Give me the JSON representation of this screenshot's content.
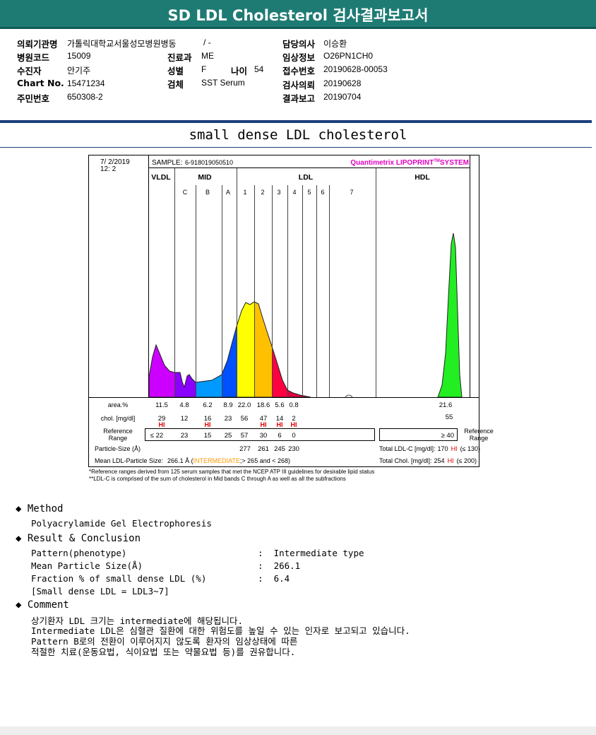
{
  "header": {
    "title": "SD LDL Cholesterol 검사결과보고서"
  },
  "info": {
    "institution": {
      "label": "의뢰기관명",
      "value": "가톨릭대학교서울성모병원병동",
      "ward": "/ -"
    },
    "doctor": {
      "label": "담당의사",
      "value": "이승환"
    },
    "hospital_code": {
      "label": "병원코드",
      "value": "15009"
    },
    "department": {
      "label": "진료과",
      "value": "ME"
    },
    "clinical_info": {
      "label": "임상정보",
      "value": "O26PN1CH0"
    },
    "patient": {
      "label": "수진자",
      "value": "안기주"
    },
    "sex": {
      "label": "성별",
      "value": "F"
    },
    "age": {
      "label": "나이",
      "value": "54"
    },
    "receipt_no": {
      "label": "접수번호",
      "value": "20190628-00053"
    },
    "chart_no": {
      "label": "Chart No.",
      "value": "15471234"
    },
    "specimen": {
      "label": "검체",
      "value": "SST Serum"
    },
    "request_date": {
      "label": "검사의뢰",
      "value": "20190628"
    },
    "resident_no": {
      "label": "주민번호",
      "value": "650308-2"
    },
    "report_date": {
      "label": "결과보고",
      "value": "20190704"
    }
  },
  "section_title": "small dense LDL cholesterol",
  "lipoprint": {
    "date": "7/ 2/2019",
    "time": "12: 2",
    "sample_label": "SAMPLE:",
    "sample": "6-918019050510",
    "brand": "Quantimetrix LIPOPRINT",
    "brand_tm": "TM",
    "brand_suffix": "SYSTEM",
    "groups": [
      "VLDL",
      "MID",
      "LDL",
      "HDL"
    ],
    "bands": [
      "C",
      "B",
      "A",
      "1",
      "2",
      "3",
      "4",
      "5",
      "6",
      "7"
    ],
    "area_label": "area.%",
    "area": [
      "11.5",
      "4.8",
      "6.2",
      "8.9",
      "22.0",
      "18.6",
      "5.6",
      "0.8"
    ],
    "hdl_area": "21.6",
    "chol_label": "chol. [mg/dl]",
    "chol": [
      "29",
      "12",
      "16",
      "23",
      "56",
      "47",
      "14",
      "2"
    ],
    "hdl_chol": "55",
    "hi_flags": [
      true,
      false,
      true,
      false,
      false,
      true,
      true,
      true
    ],
    "hi_text": "HI",
    "ref_label": "Reference Range",
    "ref": [
      "≤ 22",
      "23",
      "15",
      "25",
      "57",
      "30",
      "6",
      "0"
    ],
    "hdl_ref": "≥ 40",
    "particle_label": "Particle-Size (Å)",
    "particle": [
      "277",
      "261",
      "245",
      "230"
    ],
    "mean_label": "Mean LDL-Particle Size:",
    "mean_value": "266.1 Å",
    "mean_class": "INTERMEDIATE",
    "mean_range": ";> 265 and < 268)",
    "total_ldl_label": "Total LDL-C [mg/dl]:",
    "total_ldl": "170",
    "total_ldl_ref": "(≤ 130)",
    "total_chol_label": "Total Chol. [mg/dl]:",
    "total_chol": "254",
    "total_chol_ref": "(≤ 200)",
    "footnote1": "*Reference ranges derived from 125 serum samples that met the NCEP ATP III guidelines for desirable lipid status",
    "footnote2": "**LDL-C is comprised of the sum of cholesterol in Mid bands C through A as well as all the subfractions",
    "colors": {
      "VLDL": "#cc00ff",
      "C": "#8a00ff",
      "B": "#0099ff",
      "A": "#0050ff",
      "1": "#ffff00",
      "2": "#ffc000",
      "3": "#ff0040",
      "4": "#e00040",
      "HDL": "#22ee22",
      "hi": "#e00000",
      "intermediate": "#ff9900",
      "brand": "#e000c0"
    }
  },
  "method": {
    "title": "Method",
    "text": "Polyacrylamide Gel Electrophoresis"
  },
  "result": {
    "title": "Result & Conclusion",
    "rows": [
      {
        "label": "Pattern(phenotype)",
        "value": "Intermediate type"
      },
      {
        "label": "Mean Particle Size(Å)",
        "value": "266.1"
      },
      {
        "label": "Fraction % of small dense LDL (%)",
        "value": "6.4"
      }
    ],
    "note": "[Small dense LDL = LDL3~7]"
  },
  "comment": {
    "title": "Comment",
    "lines": [
      "상기환자 LDL 크기는 intermediate에 해당됩니다.",
      "Intermediate LDL은 심혈관 질환에 대한 위험도를 높일 수 있는 인자로 보고되고 있습니다.",
      "Pattern B로의 전환이 이루어지지 않도록 환자의 임상상태에 따른",
      "적절한 치료(운동요법, 식이요법 또는 약물요법 등)를 권유합니다."
    ]
  }
}
